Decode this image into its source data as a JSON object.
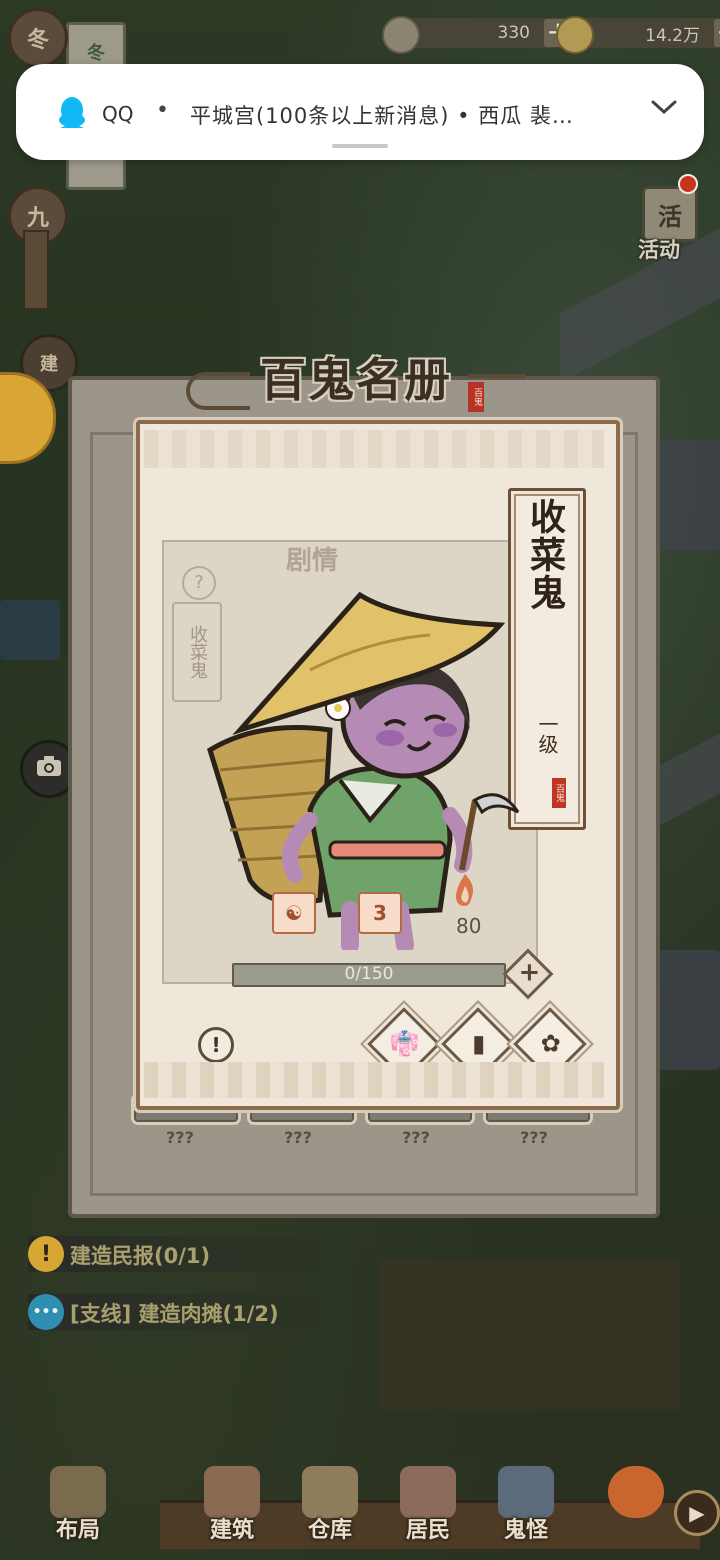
{
  "hud": {
    "silver": "330",
    "coins": "14.2万",
    "plus": "+"
  },
  "seasons": [
    "冬",
    "九"
  ],
  "season_tag": "冬",
  "notification": {
    "app": "QQ",
    "separator": "•",
    "text": "平城宫(100条以上新消息) • 西瓜 裴…",
    "expand": "⌄"
  },
  "activity": {
    "icon_char": "活",
    "label": "活动"
  },
  "side": {
    "build": "建"
  },
  "modal": {
    "title": "百鬼名册",
    "stamp": "百鬼",
    "bg_title": "剧情",
    "bg_tag": "收菜鬼",
    "placeholder": "???"
  },
  "ghost": {
    "name": "收菜鬼",
    "level": "一级",
    "stamp": "百鬼",
    "stat2": "3",
    "fire_value": "80",
    "progress_label": "0/150",
    "progress_fraction": 0
  },
  "quests": [
    {
      "icon": "!",
      "text": "建造民报(0/1)",
      "icon_color": "#d7a733"
    },
    {
      "icon": "•••",
      "text": "[支线] 建造肉摊(1/2)",
      "icon_color": "#2f8fb0"
    }
  ],
  "nav": [
    "布局",
    "建筑",
    "仓库",
    "居民",
    "鬼怪"
  ],
  "colors": {
    "accent_brown": "#8a6b4c",
    "parchment": "#efe7da",
    "qq_blue": "#12b7f5"
  }
}
